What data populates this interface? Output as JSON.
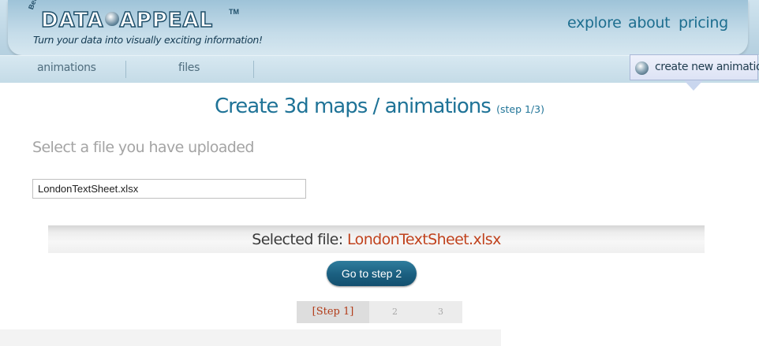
{
  "brand": {
    "beta": "Beta",
    "logo_left": "DATA",
    "logo_right": "APPEAL",
    "trademark": "TM",
    "tagline": "Turn your data into visually exciting information!"
  },
  "topnav": {
    "items": [
      "explore",
      "about",
      "pricing"
    ]
  },
  "subnav": {
    "tabs": [
      "animations",
      "files"
    ],
    "create_button": "create new animation"
  },
  "main": {
    "title": "Create 3d maps / animations",
    "title_step": "(step 1/3)",
    "select_label": "Select a file you have uploaded",
    "file_input_value": "LondonTextSheet.xlsx",
    "selected_prefix": "Selected file:",
    "selected_file": "LondonTextSheet.xlsx",
    "go_button": "Go to step 2"
  },
  "steps": {
    "current": "[Step 1]",
    "step2": "2",
    "step3": "3"
  },
  "colors": {
    "accent": "#1f7397",
    "highlight": "#c0421d",
    "button": "#1b5f80"
  }
}
